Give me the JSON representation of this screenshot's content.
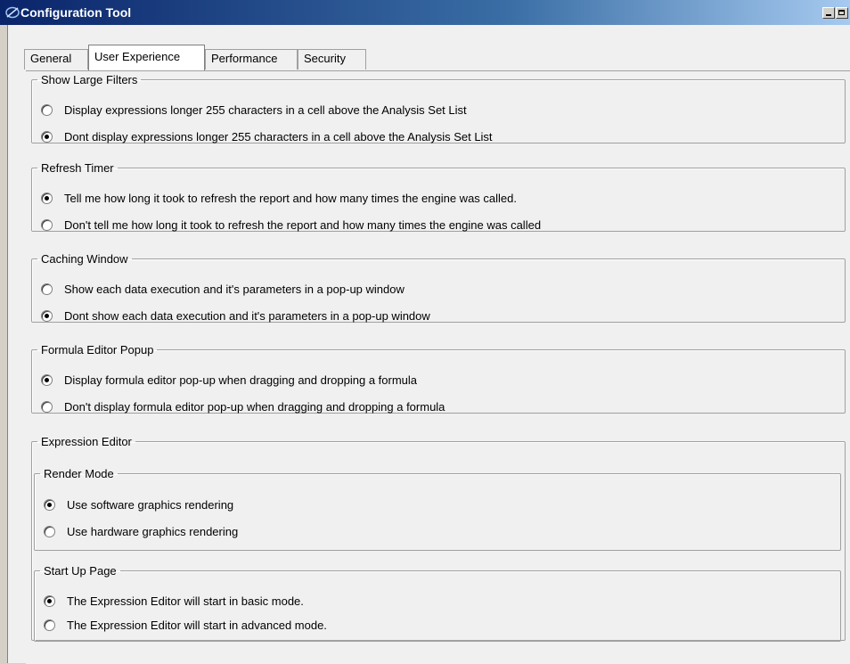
{
  "window": {
    "title": "Configuration Tool"
  },
  "tabs": [
    {
      "label": "General",
      "active": false
    },
    {
      "label": "User Experience",
      "active": true
    },
    {
      "label": "Performance",
      "active": false
    },
    {
      "label": "Security",
      "active": false
    }
  ],
  "groups": {
    "show_large_filters": {
      "title": "Show Large Filters",
      "options": [
        {
          "label": "Display expressions longer 255 characters in a cell above the Analysis Set List",
          "checked": false
        },
        {
          "label": "Dont display expressions longer 255 characters in a cell above the Analysis Set List",
          "checked": true
        }
      ]
    },
    "refresh_timer": {
      "title": "Refresh Timer",
      "options": [
        {
          "label": "Tell me how long it took to refresh the report and how many times the engine was called.",
          "checked": true
        },
        {
          "label": "Don't tell me how long it took to refresh the report and how many times the engine was called",
          "checked": false
        }
      ]
    },
    "caching_window": {
      "title": "Caching Window",
      "options": [
        {
          "label": "Show each data execution and it's parameters in a pop-up window",
          "checked": false
        },
        {
          "label": "Dont show each data execution and it's parameters in a pop-up window",
          "checked": true
        }
      ]
    },
    "formula_editor_popup": {
      "title": "Formula Editor Popup",
      "options": [
        {
          "label": "Display formula editor pop-up when dragging and dropping a formula",
          "checked": true
        },
        {
          "label": "Don't display formula editor pop-up when dragging and dropping a formula",
          "checked": false
        }
      ]
    },
    "expression_editor": {
      "title": "Expression Editor",
      "render_mode": {
        "title": "Render Mode",
        "options": [
          {
            "label": "Use software graphics rendering",
            "checked": true
          },
          {
            "label": "Use hardware graphics rendering",
            "checked": false
          }
        ]
      },
      "start_up_page": {
        "title": "Start Up Page",
        "options": [
          {
            "label": "The Expression Editor will start in basic mode.",
            "checked": true
          },
          {
            "label": "The Expression Editor will start in advanced mode.",
            "checked": false
          }
        ]
      }
    }
  }
}
